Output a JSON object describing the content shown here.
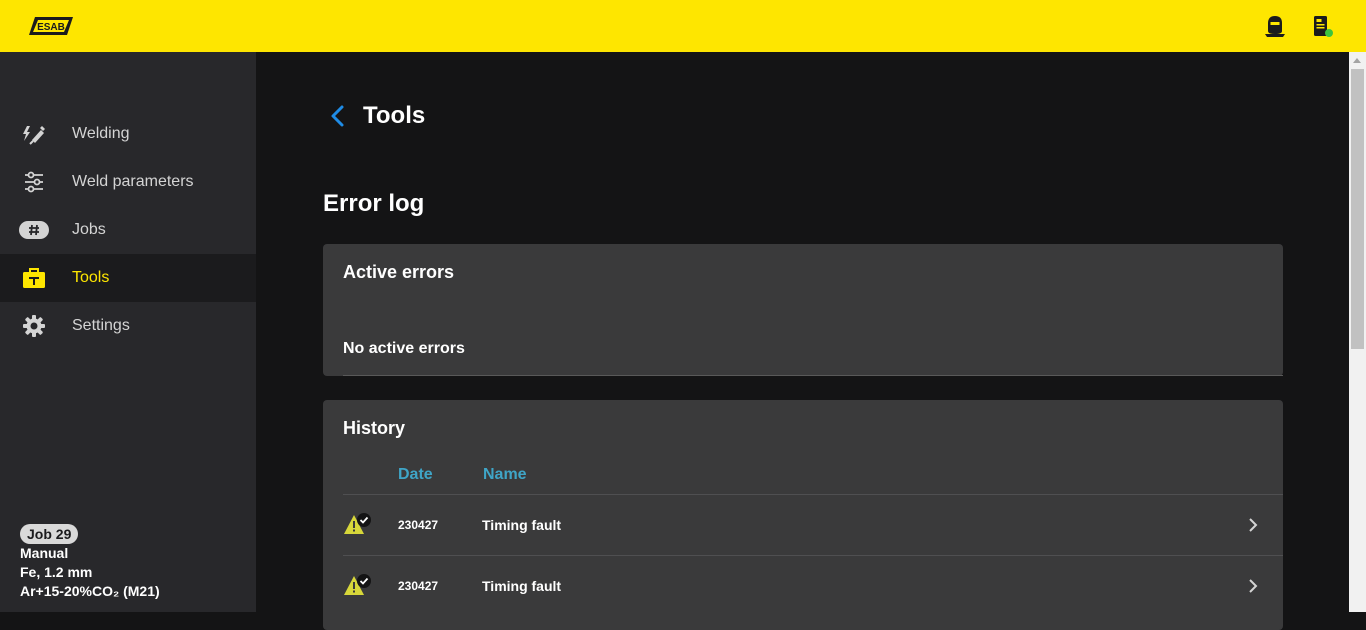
{
  "brand": {
    "logo_text": "ESAB",
    "accent": "#fee600",
    "link_blue": "#3fa5c7",
    "back_blue": "#1f8ce6"
  },
  "topbar": {
    "icons": [
      "welder-helmet-icon",
      "machine-status-icon"
    ],
    "status_color": "#3ec33e"
  },
  "sidebar": {
    "items": [
      {
        "label": "Welding",
        "icon": "welding-torch-icon"
      },
      {
        "label": "Weld parameters",
        "icon": "sliders-icon"
      },
      {
        "label": "Jobs",
        "icon": "hash-icon"
      },
      {
        "label": "Tools",
        "icon": "toolbox-icon",
        "active": true
      },
      {
        "label": "Settings",
        "icon": "gear-icon"
      }
    ],
    "job": {
      "badge": "Job 29",
      "mode": "Manual",
      "material": "Fe, 1.2 mm",
      "gas": "Ar+15-20%CO₂ (M21)"
    }
  },
  "main": {
    "page_title": "Tools",
    "section_title": "Error log",
    "active_errors": {
      "title": "Active errors",
      "empty_text": "No active errors"
    },
    "history": {
      "title": "History",
      "columns": [
        "Date",
        "Name"
      ],
      "rows": [
        {
          "date": "230427",
          "name": "Timing fault",
          "icon": "warning-acknowledged-icon"
        },
        {
          "date": "230427",
          "name": "Timing fault",
          "icon": "warning-acknowledged-icon"
        }
      ]
    }
  }
}
